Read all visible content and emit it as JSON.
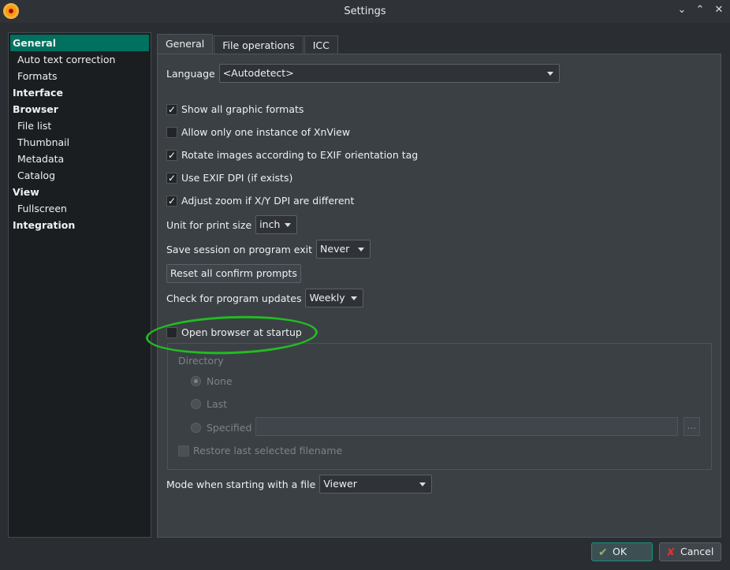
{
  "window": {
    "title": "Settings"
  },
  "sidebar": {
    "items": [
      {
        "label": "General",
        "top": true,
        "selected": true
      },
      {
        "label": "Auto text correction"
      },
      {
        "label": "Formats"
      },
      {
        "label": "Interface",
        "top": true
      },
      {
        "label": "Browser",
        "top": true
      },
      {
        "label": "File list"
      },
      {
        "label": "Thumbnail"
      },
      {
        "label": "Metadata"
      },
      {
        "label": "Catalog"
      },
      {
        "label": "View",
        "top": true
      },
      {
        "label": "Fullscreen"
      },
      {
        "label": "Integration",
        "top": true
      }
    ]
  },
  "tabs": [
    "General",
    "File operations",
    "ICC"
  ],
  "general": {
    "language_label": "Language",
    "language_value": "<Autodetect>",
    "checks": [
      {
        "label": "Show all graphic formats",
        "checked": true
      },
      {
        "label": "Allow only one instance of XnView",
        "checked": false
      },
      {
        "label": "Rotate images according to EXIF orientation tag",
        "checked": true
      },
      {
        "label": "Use EXIF DPI (if exists)",
        "checked": true
      },
      {
        "label": "Adjust zoom if X/Y DPI are different",
        "checked": true
      }
    ],
    "unit_label": "Unit for print size",
    "unit_value": "inch",
    "session_label": "Save session on program exit",
    "session_value": "Never",
    "reset_button": "Reset all confirm prompts",
    "updates_label": "Check for program updates",
    "updates_value": "Weekly",
    "open_browser_label": "Open browser at startup",
    "directory_label": "Directory",
    "radio_none": "None",
    "radio_last": "Last",
    "radio_specified": "Specified",
    "browse_button": "...",
    "restore_label": "Restore last selected filename",
    "mode_label": "Mode when starting with a file",
    "mode_value": "Viewer"
  },
  "buttons": {
    "ok": "OK",
    "cancel": "Cancel"
  },
  "colors": {
    "accent": "#00705f",
    "highlight": "#22bb22"
  }
}
